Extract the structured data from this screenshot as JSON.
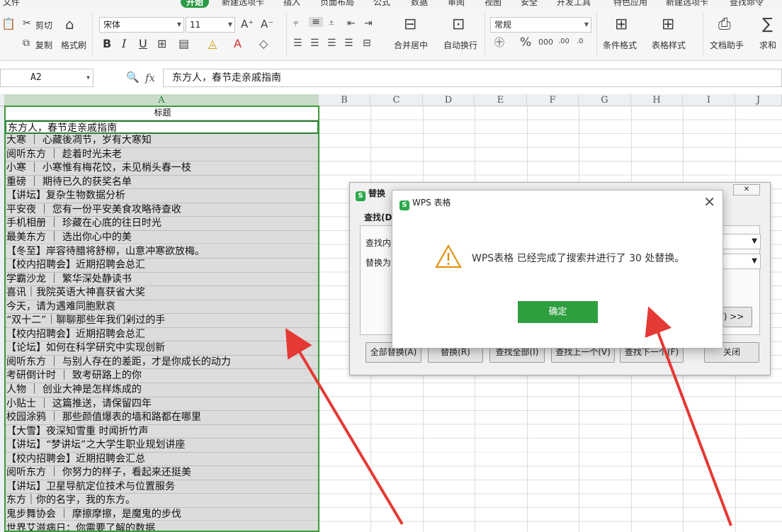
{
  "menu": [
    "文件",
    "开始",
    "新建选项卡",
    "插入",
    "页面布局",
    "公式",
    "数据",
    "审阅",
    "视图",
    "安全",
    "开发工具",
    "特色应用",
    "新建选项卡",
    "查找命令"
  ],
  "ribbon": {
    "cut": "剪切",
    "copy": "复制",
    "format_painter": "格式刷",
    "font_name": "宋体",
    "font_size": "11",
    "number_format": "常规",
    "merge": "合并居中",
    "wrap": "自动换行",
    "cond_format": "条件格式",
    "table_style": "表格样式",
    "doc_helper": "文档助手",
    "sum": "求和",
    "bold": "B",
    "italic": "I",
    "underline": "U"
  },
  "formula_bar": {
    "cell_ref": "A2",
    "fx": "fx",
    "content": "东方人，春节走亲戚指南"
  },
  "columns": [
    "A",
    "B",
    "C",
    "D",
    "E",
    "F",
    "G",
    "H",
    "I",
    "J"
  ],
  "cells": [
    {
      "text": "标题",
      "hl": false
    },
    {
      "text": "东方人，春节走亲戚指南",
      "hl": false
    },
    {
      "text": "大寒 ｜ 心藏後凋节，岁有大寒知",
      "hl": true
    },
    {
      "text": "阅听东方 ｜ 趁着时光未老",
      "hl": true
    },
    {
      "text": "小寒 ｜ 小寒惟有梅花饺，未见梢头春一枝",
      "hl": true
    },
    {
      "text": "重磅 ｜ 期待已久的获奖名单",
      "hl": true
    },
    {
      "text": "【讲坛】复杂生物数据分析",
      "hl": true
    },
    {
      "text": "平安夜 ｜ 您有一份平安美食攻略待查收",
      "hl": true
    },
    {
      "text": "手机相册 ｜ 珍藏在心底的往日时光",
      "hl": true
    },
    {
      "text": "最美东方 ｜ 选出你心中的美",
      "hl": true
    },
    {
      "text": "【冬至】岸容待腊将舒柳，山意冲寒欲放梅。",
      "hl": true
    },
    {
      "text": "【校内招聘会】近期招聘会总汇",
      "hl": true
    },
    {
      "text": "学霸沙龙 ｜ 繁华深处静读书",
      "hl": true
    },
    {
      "text": "喜讯｜我院英语大神喜获省大奖",
      "hl": true
    },
    {
      "text": "今天，请为遇难同胞默哀",
      "hl": true
    },
    {
      "text": "“双十二”｜聊聊那些年我们剁过的手",
      "hl": true
    },
    {
      "text": "【校内招聘会】近期招聘会总汇",
      "hl": true
    },
    {
      "text": "【论坛】如何在科学研究中实现创新",
      "hl": true
    },
    {
      "text": "阅听东方 ｜ 与别人存在的差距，才是你成长的动力",
      "hl": true
    },
    {
      "text": "考研倒计时 ｜ 致考研路上的你",
      "hl": true
    },
    {
      "text": "人物 ｜ 创业大神是怎样炼成的",
      "hl": true
    },
    {
      "text": "小贴士 ｜ 这篇推送，请保留四年",
      "hl": true
    },
    {
      "text": "校园涂鸦 ｜ 那些颜值爆表的墙和路都在哪里",
      "hl": true
    },
    {
      "text": "【大雪】夜深知雪重 时闻折竹声",
      "hl": true
    },
    {
      "text": "【讲坛】“梦讲坛”之大学生职业规划讲座",
      "hl": true
    },
    {
      "text": "【校内招聘会】近期招聘会汇总",
      "hl": true
    },
    {
      "text": "阅听东方 ｜ 你努力的样子，看起来还挺美",
      "hl": true
    },
    {
      "text": "【讲坛】卫星导航定位技术与位置服务",
      "hl": true
    },
    {
      "text": "东方｜你的名字，我的东方。",
      "hl": true
    },
    {
      "text": "鬼步舞协会 ｜ 摩擦摩擦，是魔鬼的步伐",
      "hl": true
    },
    {
      "text": "世界艾滋病日：你需要了解的数据",
      "hl": true
    }
  ],
  "replace_dialog": {
    "title": "替换",
    "tab_find": "查找(D)",
    "find_label": "查找内容(N):",
    "replace_label": "替换为(E):",
    "options_btn": "选项(T) >>",
    "buttons": [
      "全部替换(A)",
      "替换(R)",
      "查找全部(I)",
      "查找上一个(V)",
      "查找下一个(F)",
      "关闭"
    ]
  },
  "alert": {
    "title": "WPS 表格",
    "message": "WPS表格 已经完成了搜索并进行了 30 处替换。",
    "ok": "确定"
  },
  "colors": {
    "accent": "#2f9e3f",
    "arrow": "#e53935"
  }
}
